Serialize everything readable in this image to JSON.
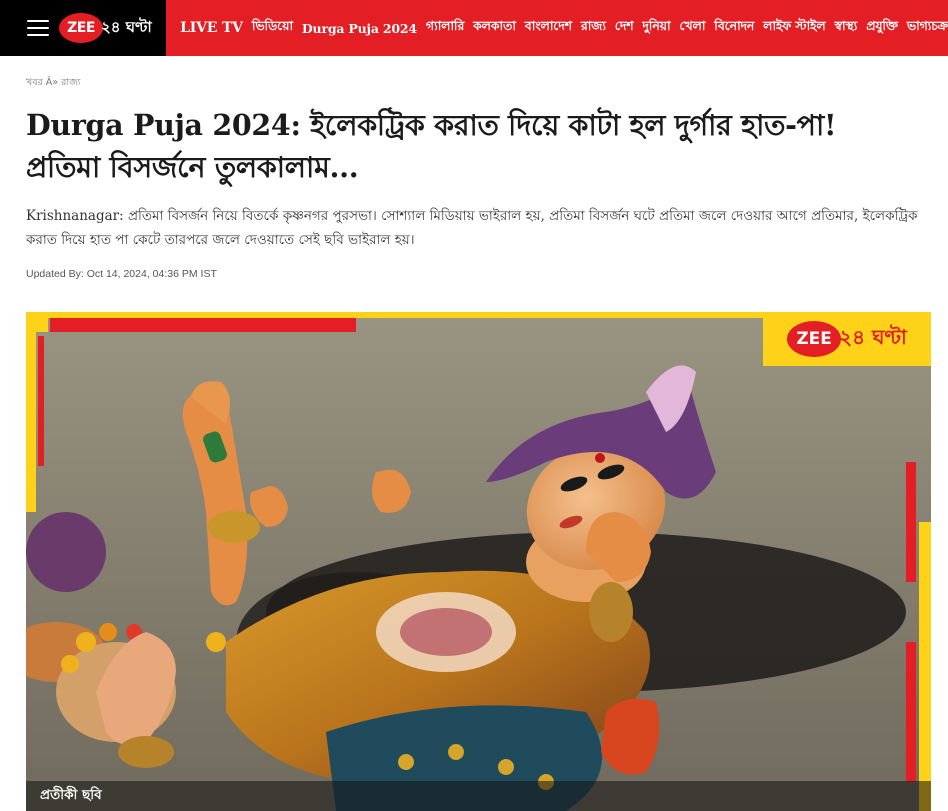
{
  "header": {
    "logo_mark": "ZEE",
    "logo_tail": "২৪ ঘণ্টা",
    "nav": [
      "LIVE TV",
      "ভিডিয়ো",
      "Durga Puja 2024",
      "গ্যালারি",
      "কলকাতা",
      "বাংলাদেশ",
      "রাজ্য",
      "দেশ",
      "দুনিয়া",
      "খেলা",
      "বিনোদন",
      "লাইফ স্টাইল",
      "স্বাস্থ্য",
      "প্রযুক্তি",
      "ভাগ্যচক্র"
    ]
  },
  "breadcrumb": {
    "home": "খবর",
    "separator": "Â»",
    "section": "রাজ্য"
  },
  "article": {
    "headline": "Durga Puja 2024: ইলেকট্রিক করাত দিয়ে কাটা হল দুর্গার হাত-পা! প্রতিমা বিসর্জনে তুলকালাম...",
    "summary": "Krishnanagar: প্রতিমা বিসর্জন নিয়ে বিতর্কে কৃষ্ণনগর পুরসভা। সোশ্যাল মিডিয়ায় ভাইরাল হয়, প্রতিমা বিসর্জন ঘটে প্রতিমা জলে দেওয়ার আগে প্রতিমার, ইলেকট্রিক করাত দিয়ে হাত পা কেটে তারপরে জলে দেওয়াতে সেই ছবি ভাইরাল হয়।",
    "updated": "Updated By: Oct 14, 2024, 04:36 PM IST"
  },
  "photo": {
    "caption": "প্রতীকী ছবি",
    "logo_mark": "ZEE",
    "logo_tail": "২৪ ঘণ্টা"
  },
  "colors": {
    "brand_red": "#e31e24",
    "header_black": "#000000",
    "logo_yellow": "#ffd21a"
  }
}
